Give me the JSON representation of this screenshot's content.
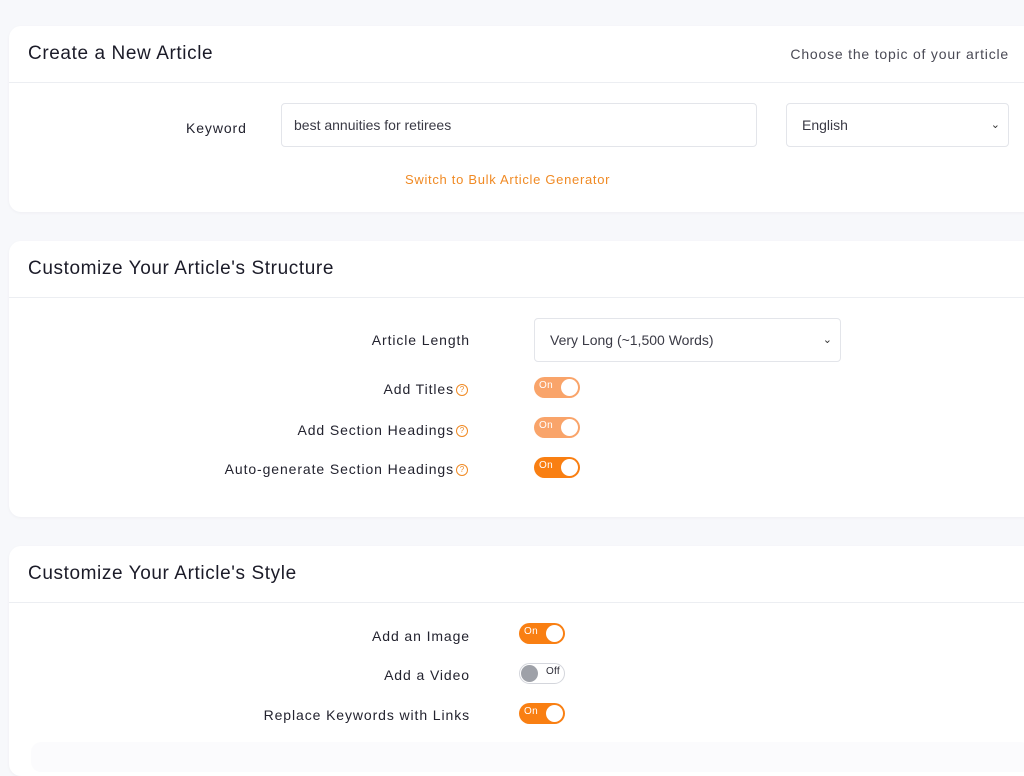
{
  "create_card": {
    "title": "Create a New Article",
    "hint": "Choose the topic of your article",
    "keyword_label": "Keyword",
    "keyword_value": "best annuities for retirees",
    "language_selected": "English",
    "bulk_link": "Switch to Bulk Article Generator"
  },
  "structure_card": {
    "title": "Customize Your Article's Structure",
    "length_label": "Article Length",
    "length_selected": "Very Long (~1,500 Words)",
    "options": [
      {
        "label": "Add Titles",
        "state": "On",
        "help_icon": "question-circle-icon"
      },
      {
        "label": "Add Section Headings",
        "state": "On",
        "help_icon": "question-circle-icon"
      },
      {
        "label": "Auto-generate Section Headings",
        "state": "On",
        "help_icon": "question-circle-icon"
      }
    ]
  },
  "style_card": {
    "title": "Customize Your Article's Style",
    "options": [
      {
        "label": "Add an Image",
        "state": "On"
      },
      {
        "label": "Add a Video",
        "state": "Off"
      },
      {
        "label": "Replace Keywords with Links",
        "state": "On"
      }
    ]
  },
  "colors": {
    "accent": "#f97f12",
    "accent_soft": "#f9a46a",
    "background": "#f7f8fb"
  }
}
